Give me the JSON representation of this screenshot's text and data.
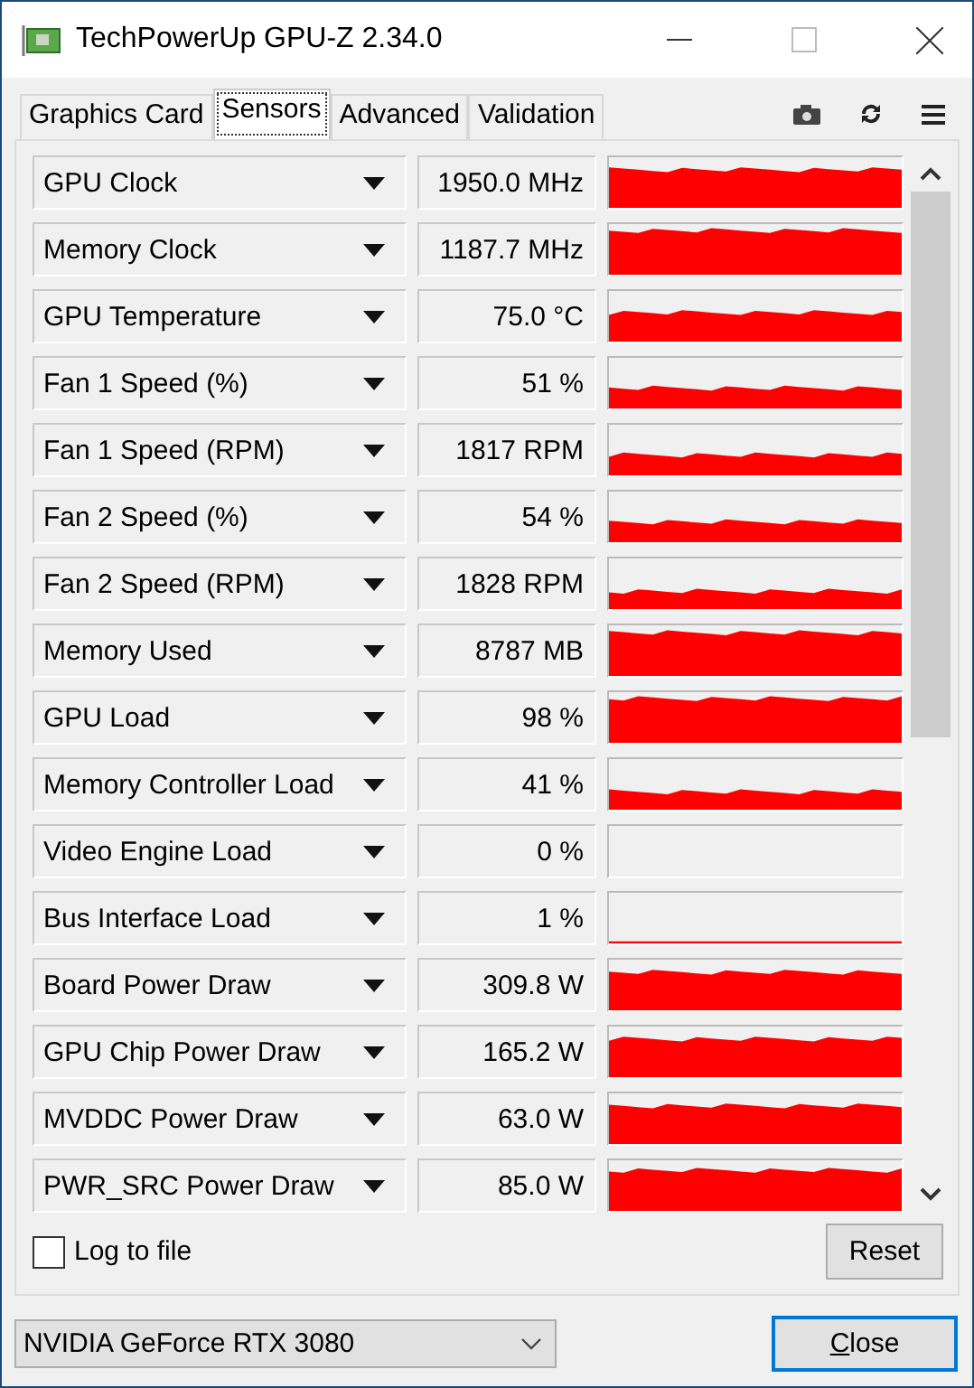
{
  "window": {
    "title": "TechPowerUp GPU-Z 2.34.0"
  },
  "tabs": [
    {
      "label": "Graphics Card",
      "selected": false
    },
    {
      "label": "Sensors",
      "selected": true
    },
    {
      "label": "Advanced",
      "selected": false
    },
    {
      "label": "Validation",
      "selected": false
    }
  ],
  "sensors": [
    {
      "name": "GPU Clock",
      "value": "1950.0 MHz"
    },
    {
      "name": "Memory Clock",
      "value": "1187.7 MHz"
    },
    {
      "name": "GPU Temperature",
      "value": "75.0 °C"
    },
    {
      "name": "Fan 1 Speed (%)",
      "value": "51 %"
    },
    {
      "name": "Fan 1 Speed (RPM)",
      "value": "1817 RPM"
    },
    {
      "name": "Fan 2 Speed (%)",
      "value": "54 %"
    },
    {
      "name": "Fan 2 Speed (RPM)",
      "value": "1828 RPM"
    },
    {
      "name": "Memory Used",
      "value": "8787 MB"
    },
    {
      "name": "GPU Load",
      "value": "98 %"
    },
    {
      "name": "Memory Controller Load",
      "value": "41 %"
    },
    {
      "name": "Video Engine Load",
      "value": "0 %"
    },
    {
      "name": "Bus Interface Load",
      "value": "1 %"
    },
    {
      "name": "Board Power Draw",
      "value": "309.8 W"
    },
    {
      "name": "GPU Chip Power Draw",
      "value": "165.2 W"
    },
    {
      "name": "MVDDC Power Draw",
      "value": "63.0 W"
    },
    {
      "name": "PWR_SRC Power Draw",
      "value": "85.0 W"
    }
  ],
  "log_to_file": {
    "label": "Log to file",
    "checked": false
  },
  "reset_button": "Reset",
  "gpu_select": {
    "value": "NVIDIA GeForce RTX 3080"
  },
  "close_button": "Close"
}
